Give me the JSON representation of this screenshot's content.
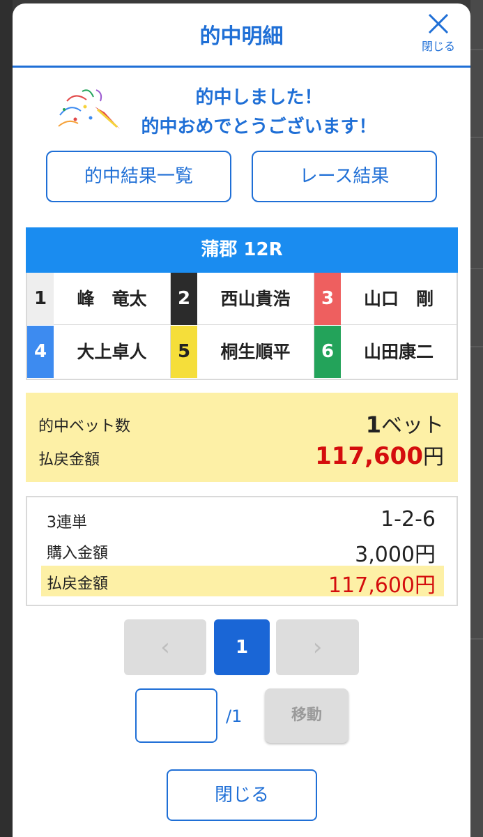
{
  "modal": {
    "title": "的中明細",
    "close_label": "閉じる"
  },
  "congrats": {
    "line1": "的中しました！",
    "line2": "的中おめでとうございます！"
  },
  "buttons": {
    "hit_list": "的中結果一覧",
    "race_result": "レース結果"
  },
  "race": {
    "title": "蒲郡 12R",
    "racers": [
      {
        "num": "1",
        "name": "峰　竜太",
        "bg": "#eeeeee",
        "fg": "#222222"
      },
      {
        "num": "2",
        "name": "西山貴浩",
        "bg": "#2b2b2b",
        "fg": "#ffffff"
      },
      {
        "num": "3",
        "name": "山口　剛",
        "bg": "#ee5f5f",
        "fg": "#ffffff"
      },
      {
        "num": "4",
        "name": "大上卓人",
        "bg": "#3d8bf0",
        "fg": "#ffffff"
      },
      {
        "num": "5",
        "name": "桐生順平",
        "bg": "#f5de3a",
        "fg": "#222222"
      },
      {
        "num": "6",
        "name": "山田康二",
        "bg": "#23a35a",
        "fg": "#ffffff"
      }
    ]
  },
  "summary": {
    "bet_count_label": "的中ベット数",
    "bet_count_value": "1",
    "bet_count_unit": "ベット",
    "payout_label": "払戻金額",
    "payout_value": "117,600",
    "payout_unit": "円"
  },
  "detail": {
    "type_label": "3連単",
    "type_value": "1-2-6",
    "purchase_label": "購入金額",
    "purchase_value": "3,000円",
    "payout_label": "払戻金額",
    "payout_value": "117,600円"
  },
  "pager": {
    "prev": "‹",
    "current": "1",
    "next": "›",
    "total": "/1",
    "move": "移動"
  },
  "footer": {
    "close": "閉じる"
  },
  "colors": {
    "accent": "#1f6fd6",
    "race_header": "#1a8cf0",
    "highlight": "#fdf0a6",
    "payout_red": "#d40d0d"
  }
}
